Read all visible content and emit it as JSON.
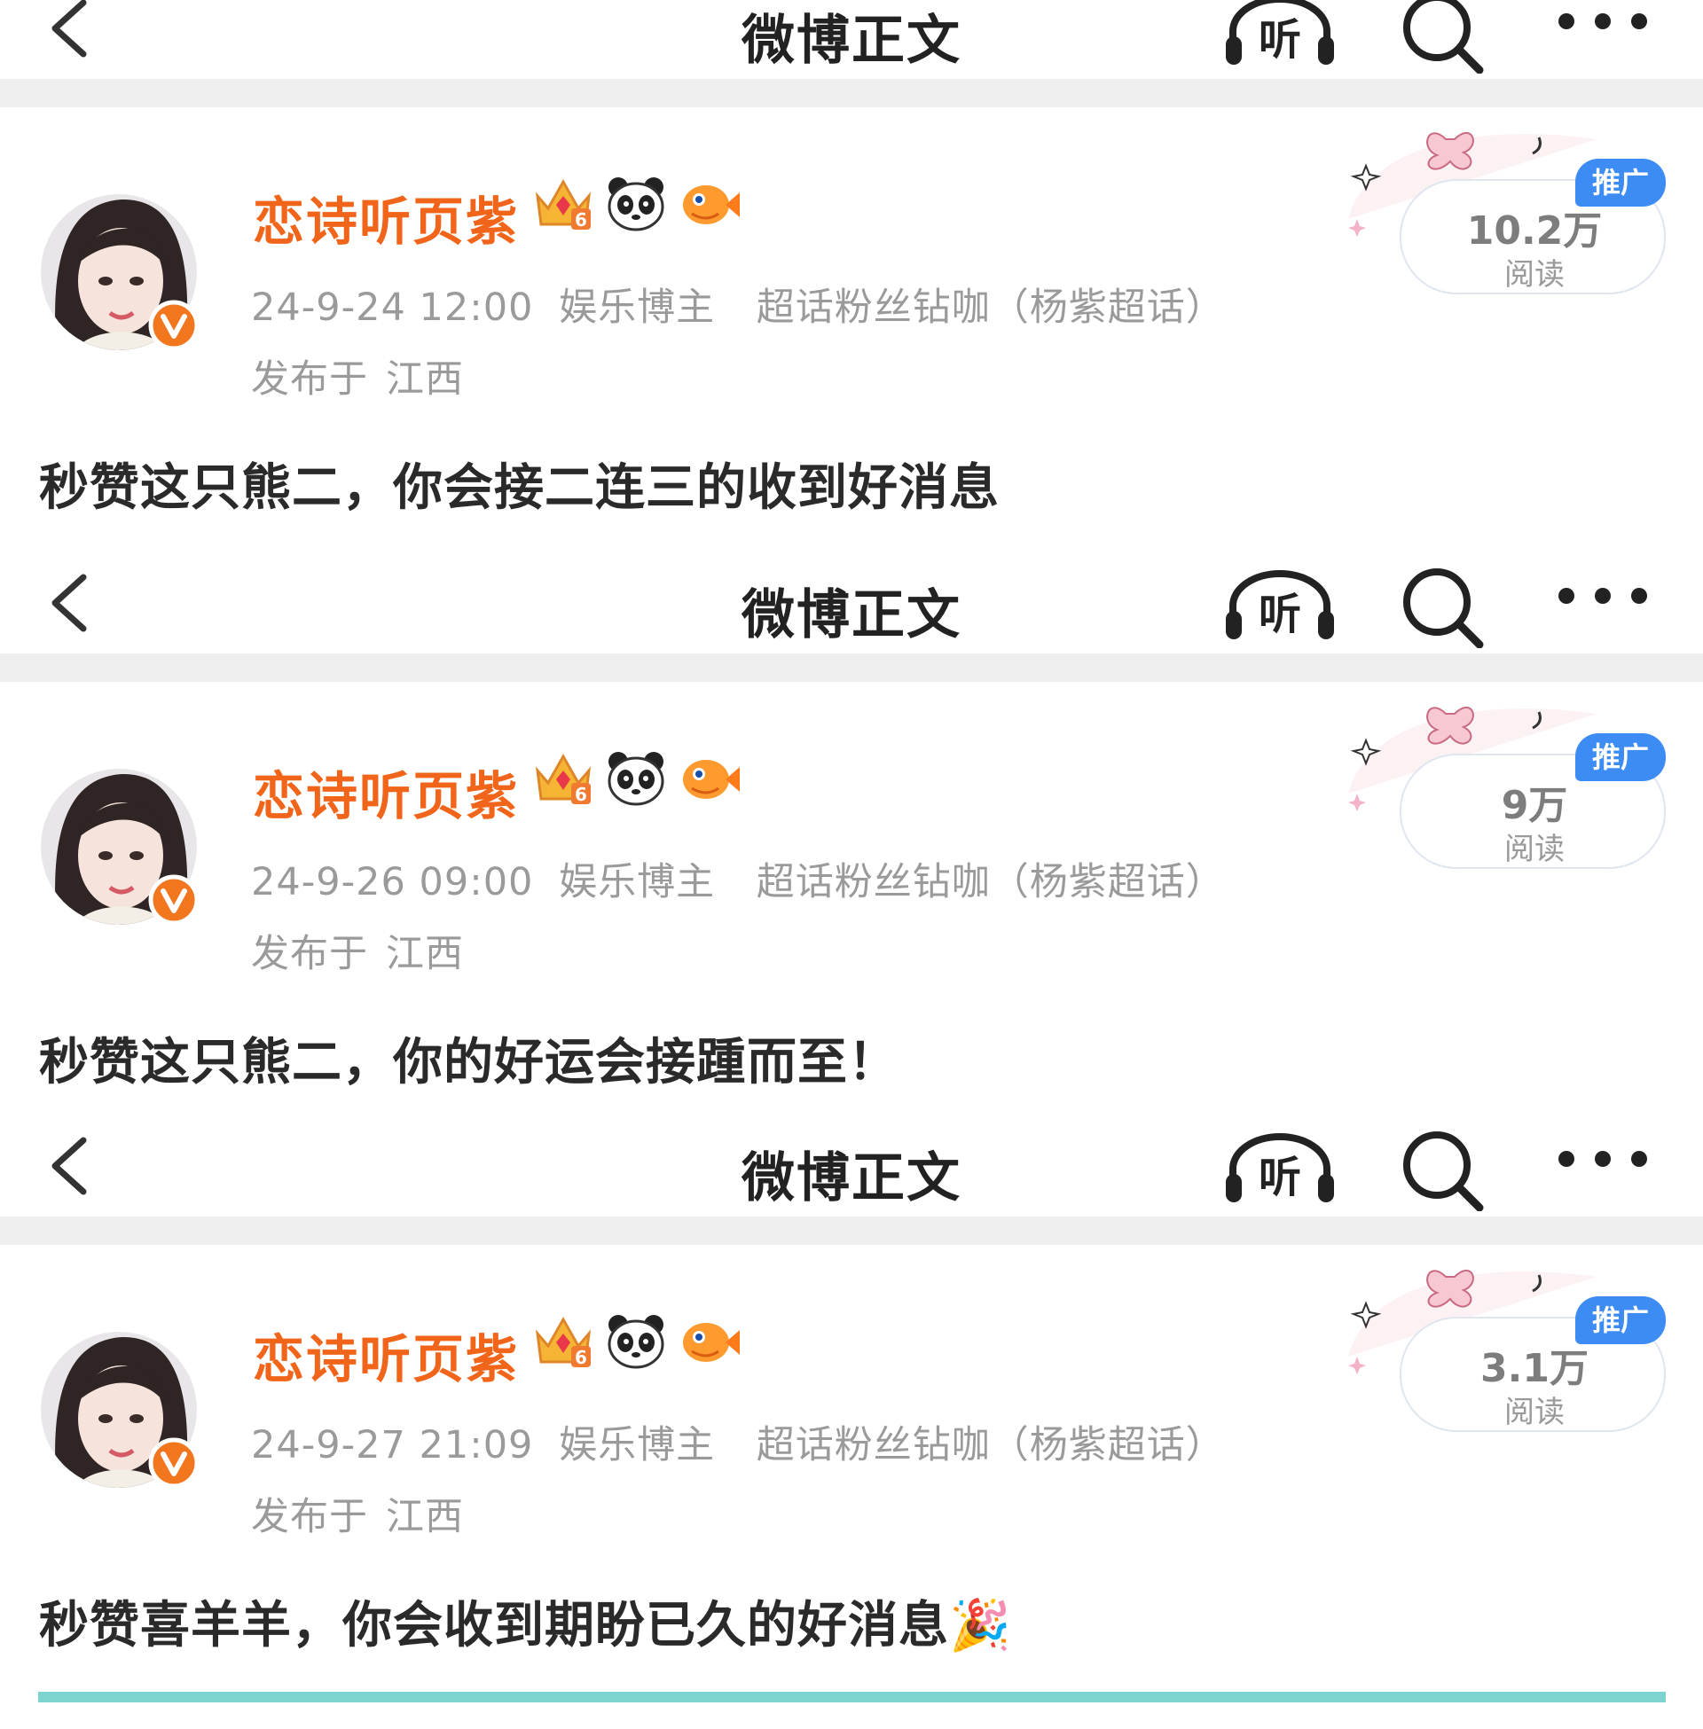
{
  "nav": {
    "title": "微博正文",
    "listen_label": "听"
  },
  "posts": [
    {
      "username": "恋诗听页紫",
      "date": "24-9-24 12:00",
      "tags": [
        "娱乐博主",
        "超话粉丝钻咖（杨紫超话）"
      ],
      "location_prefix": "发布于",
      "location": "江西",
      "reads": "10.2万",
      "reads_unit": "阅读",
      "promo": "推广",
      "content": "秒赞这只熊二，你会接二连三的收到好消息"
    },
    {
      "username": "恋诗听页紫",
      "date": "24-9-26 09:00",
      "tags": [
        "娱乐博主",
        "超话粉丝钻咖（杨紫超话）"
      ],
      "location_prefix": "发布于",
      "location": "江西",
      "reads": "9万",
      "reads_unit": "阅读",
      "promo": "推广",
      "content": "秒赞这只熊二，你的好运会接踵而至！"
    },
    {
      "username": "恋诗听页紫",
      "date": "24-9-27 21:09",
      "tags": [
        "娱乐博主",
        "超话粉丝钻咖（杨紫超话）"
      ],
      "location_prefix": "发布于",
      "location": "江西",
      "reads": "3.1万",
      "reads_unit": "阅读",
      "promo": "推广",
      "content": "秒赞喜羊羊，你会收到期盼已久的好消息🎉"
    }
  ],
  "colors": {
    "username": "#f0651a",
    "meta_text": "#9a9a9a",
    "promo_badge": "#3d8cf4",
    "verified_badge": "#f2761e",
    "separator": "#efefef"
  },
  "icons": [
    "back-arrow-icon",
    "listen-headphone-icon",
    "search-icon",
    "more-dots-icon",
    "crown-level-6-icon",
    "panda-icon",
    "pufferfish-icon",
    "verified-v-icon"
  ]
}
